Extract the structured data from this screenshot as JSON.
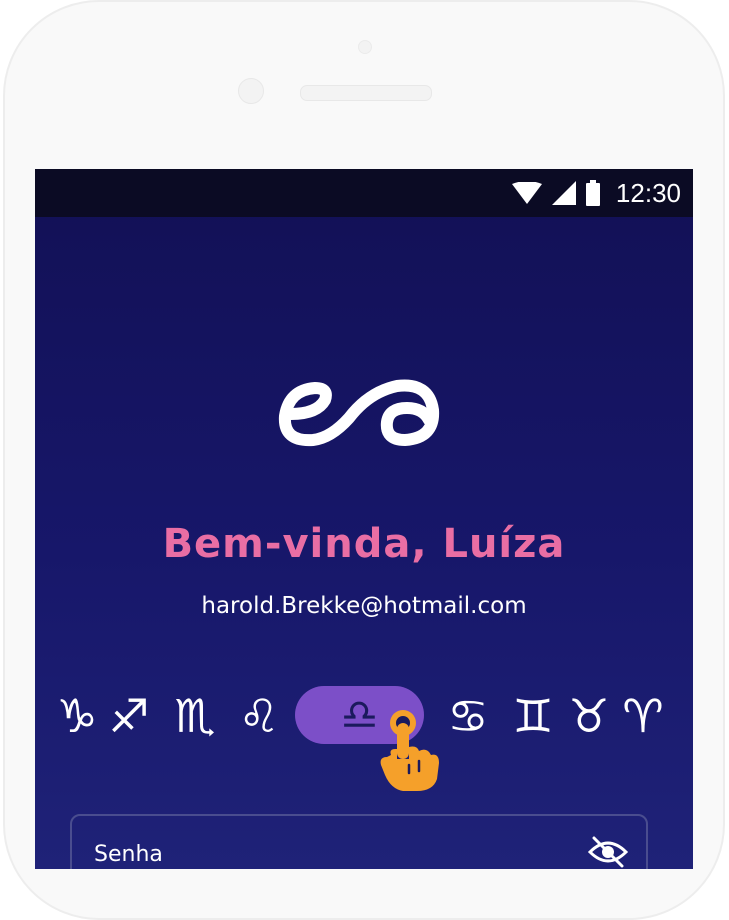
{
  "status_bar": {
    "time": "12:30",
    "icons": [
      "wifi-icon",
      "signal-icon",
      "battery-icon"
    ]
  },
  "login": {
    "welcome": "Bem-vinda, Luíza",
    "email": "harold.Brekke@hotmail.com",
    "password_label": "Senha"
  },
  "zodiac": {
    "signs": [
      {
        "name": "capricorn",
        "glyph": "♑"
      },
      {
        "name": "sagittarius",
        "glyph": "♐"
      },
      {
        "name": "scorpio",
        "glyph": "♏"
      },
      {
        "name": "leo",
        "glyph": "♌"
      },
      {
        "name": "libra",
        "glyph": "♎",
        "selected": true
      },
      {
        "name": "cancer",
        "glyph": "♋"
      },
      {
        "name": "gemini",
        "glyph": "♊"
      },
      {
        "name": "taurus",
        "glyph": "♉"
      },
      {
        "name": "aries",
        "glyph": "♈"
      }
    ]
  },
  "colors": {
    "accent_pink": "#e96ea4",
    "selected_pill": "#7c4fc8",
    "background_top": "#121055",
    "background_bottom": "#1f2278",
    "hand": "#f5a02a"
  }
}
